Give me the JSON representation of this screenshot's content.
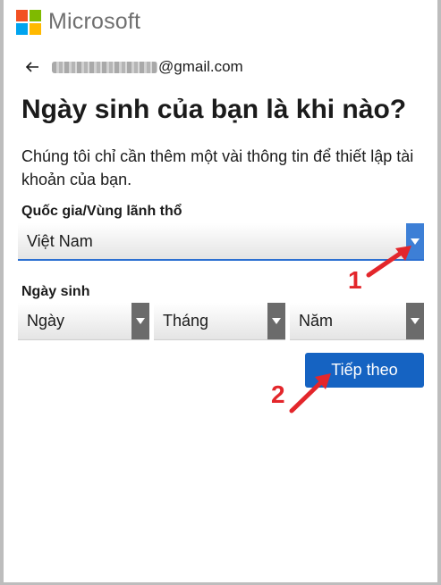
{
  "brand": {
    "name": "Microsoft",
    "logo_colors": [
      "#f25022",
      "#7fba00",
      "#00a4ef",
      "#ffb900"
    ]
  },
  "account": {
    "back_icon": "arrow-left-icon",
    "email_suffix": "@gmail.com"
  },
  "page": {
    "title": "Ngày sinh của bạn là khi nào?",
    "description": "Chúng tôi chỉ cần thêm một vài thông tin để thiết lập tài khoản của bạn."
  },
  "country": {
    "label": "Quốc gia/Vùng lãnh thổ",
    "selected": "Việt Nam"
  },
  "birthdate": {
    "label": "Ngày sinh",
    "day_selected": "Ngày",
    "month_selected": "Tháng",
    "year_selected": "Năm"
  },
  "actions": {
    "next_label": "Tiếp theo"
  },
  "annotations": {
    "step1": "1",
    "step2": "2",
    "color": "#e3262b"
  }
}
